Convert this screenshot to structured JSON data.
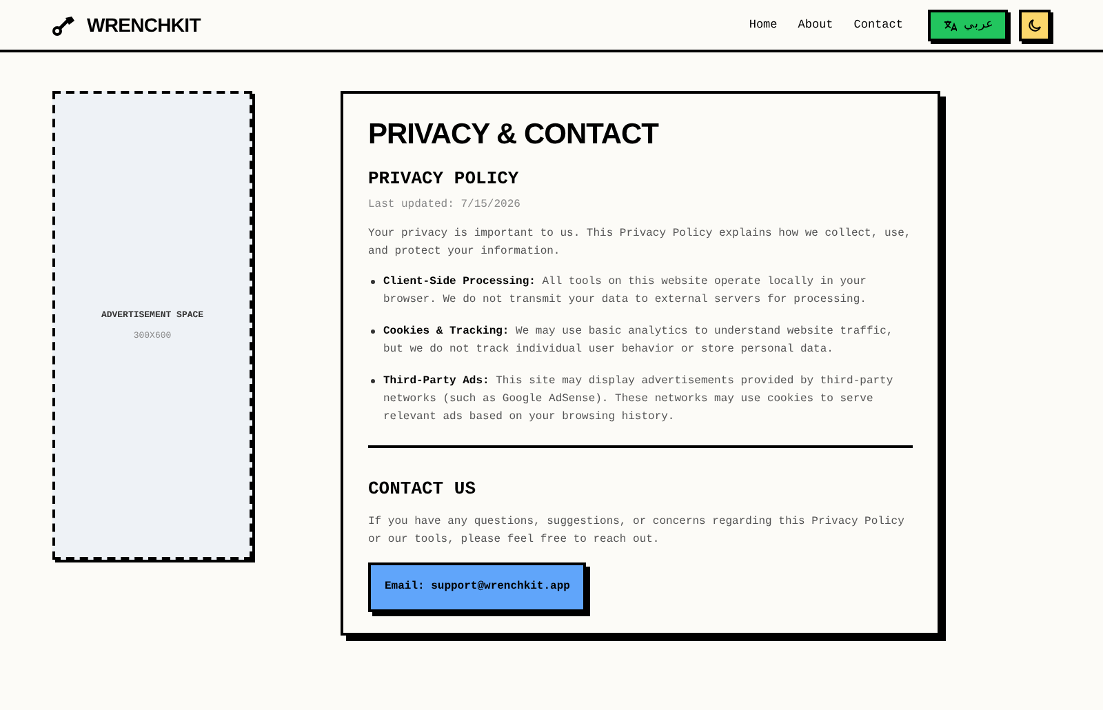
{
  "header": {
    "brand": "WRENCHKIT",
    "nav": [
      {
        "label": "Home"
      },
      {
        "label": "About"
      },
      {
        "label": "Contact"
      }
    ],
    "language_button": "عربي"
  },
  "ad": {
    "label": "ADVERTISEMENT SPACE",
    "size": "300X600"
  },
  "page": {
    "title": "PRIVACY & CONTACT",
    "privacy": {
      "heading": "PRIVACY POLICY",
      "updated": "Last updated: 7/15/2026",
      "intro": "Your privacy is important to us. This Privacy Policy explains how we collect, use, and protect your information.",
      "items": [
        {
          "text": "**Client-Side Processing:** All tools on this website operate locally in your browser. We do not transmit your data to external servers for processing."
        },
        {
          "text": "**Cookies & Tracking:** We may use basic analytics to understand website traffic, but we do not track individual user behavior or store personal data."
        },
        {
          "text": "**Third-Party Ads:** This site may display advertisements provided by third-party networks (such as Google AdSense). These networks may use cookies to serve relevant ads based on your browsing history."
        }
      ]
    },
    "contact": {
      "heading": "CONTACT US",
      "text": "If you have any questions, suggestions, or concerns regarding this Privacy Policy or our tools, please feel free to reach out.",
      "email_button": "Email: support@wrenchkit.app"
    }
  }
}
